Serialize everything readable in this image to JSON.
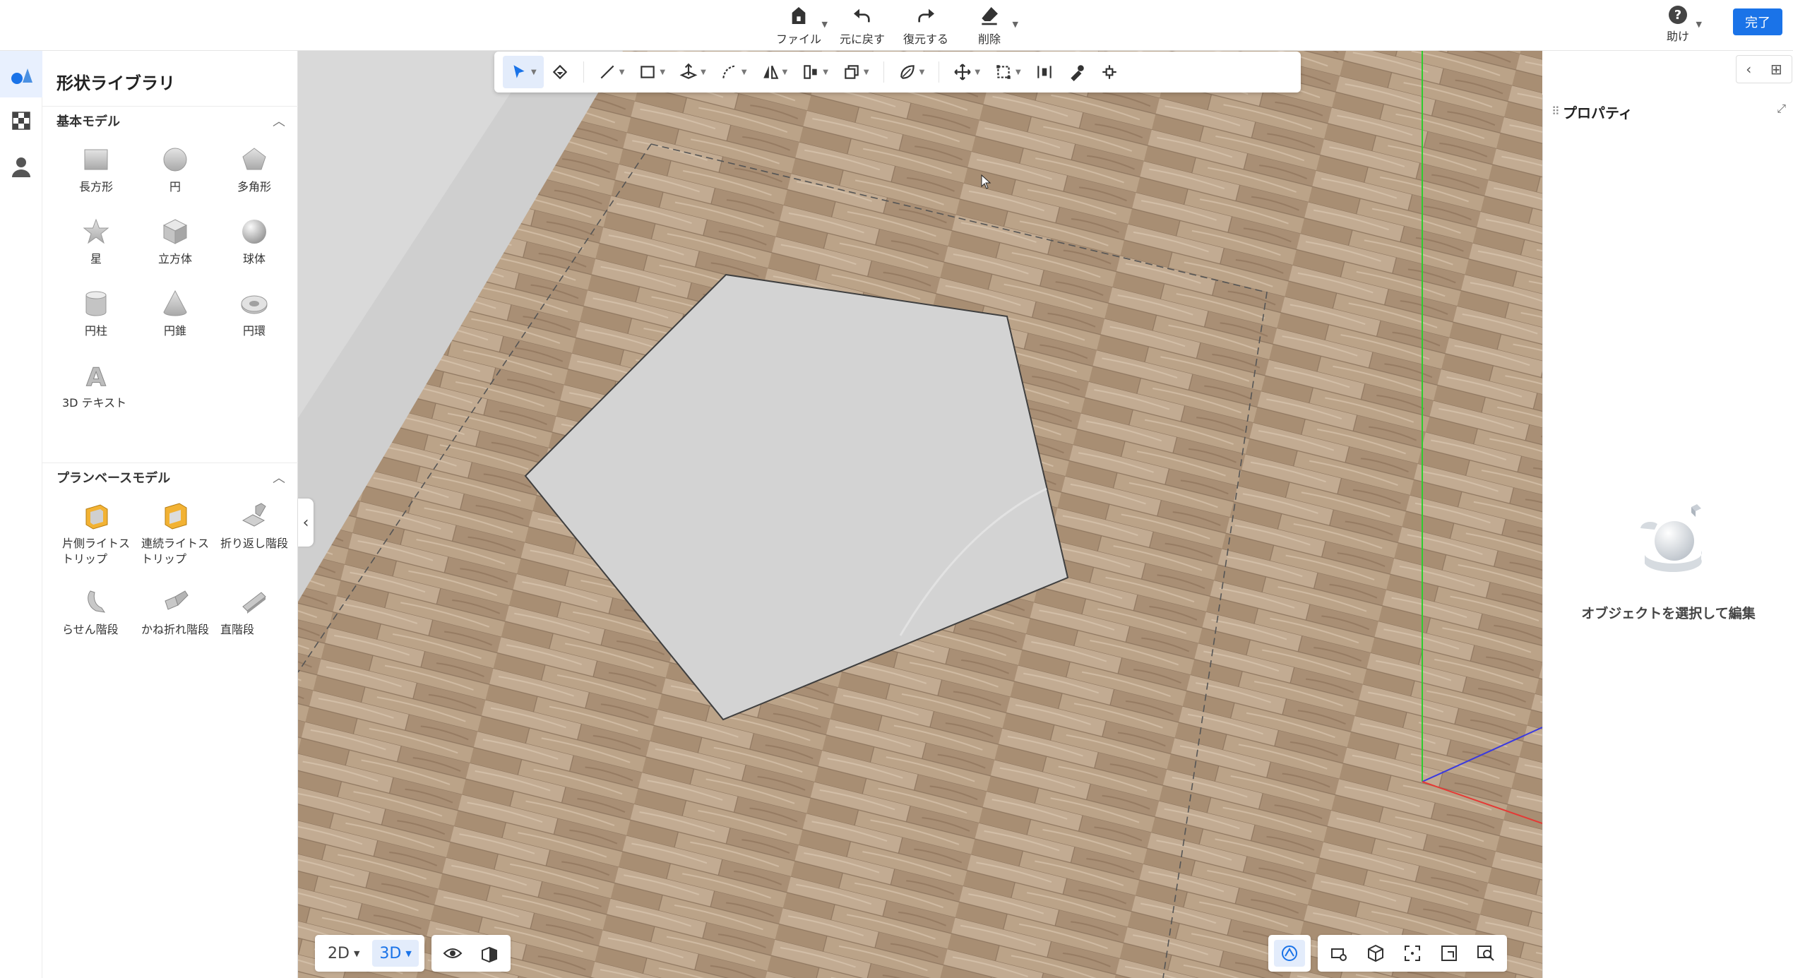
{
  "top_actions": [
    {
      "id": "file",
      "label": "ファイル",
      "icon": "house-file-icon",
      "has_dropdown": true
    },
    {
      "id": "undo",
      "label": "元に戻す",
      "icon": "undo-icon",
      "has_dropdown": false
    },
    {
      "id": "redo",
      "label": "復元する",
      "icon": "redo-icon",
      "has_dropdown": false
    },
    {
      "id": "delete",
      "label": "削除",
      "icon": "eraser-icon",
      "has_dropdown": true
    }
  ],
  "help_label": "助け",
  "help_glyph": "?",
  "done_label": "完了",
  "library": {
    "title": "形状ライブラリ",
    "basic_section": "基本モデル",
    "basic_shapes": [
      "長方形",
      "円",
      "多角形",
      "星",
      "立方体",
      "球体",
      "円柱",
      "円錐",
      "円環",
      "3D テキスト"
    ],
    "plan_section": "プランベースモデル",
    "plan_shapes": [
      "片側ライトストリップ",
      "連続ライトストリップ",
      "折り返し階段",
      "らせん階段",
      "かね折れ階段",
      "直階段"
    ]
  },
  "properties": {
    "title": "プロパティ",
    "empty_message": "オブジェクトを選択して編集"
  },
  "view_modes": {
    "two_d": "2D",
    "three_d": "3D",
    "active": "3D"
  },
  "colors": {
    "accent": "#1a73e8",
    "floor": "#b69e85",
    "pentagon_fill": "#d3d3d3",
    "axis_green": "#2ecc2e",
    "axis_red": "#e53935",
    "axis_blue": "#3a3ae0"
  }
}
